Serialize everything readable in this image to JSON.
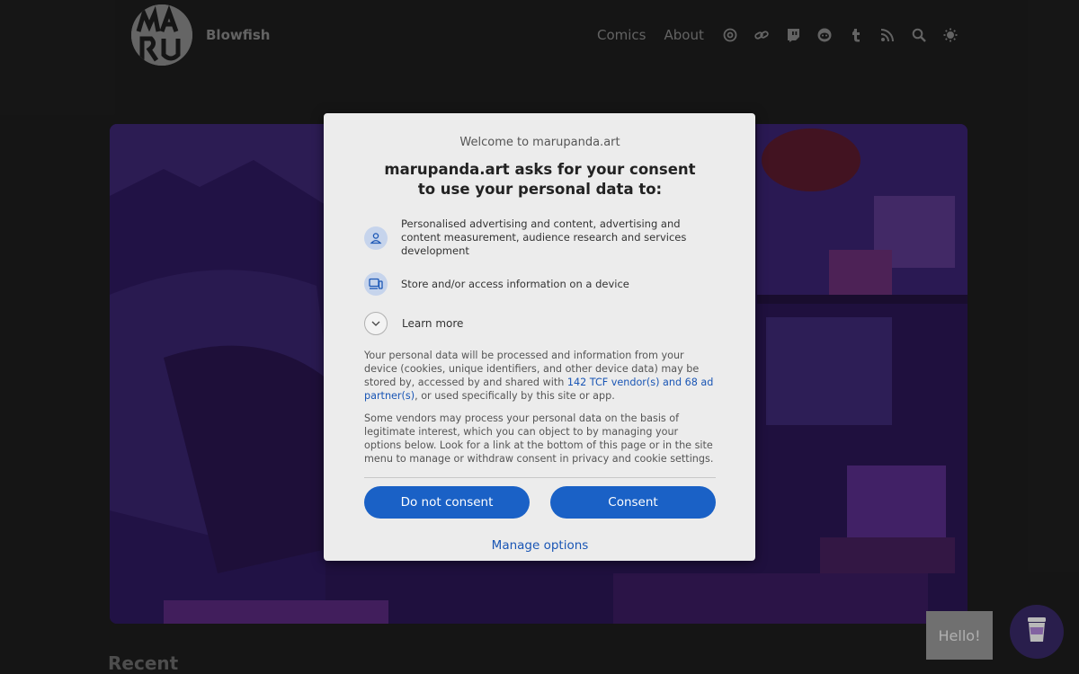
{
  "header": {
    "site_name": "Blowfish",
    "nav_links": [
      "Comics",
      "About"
    ],
    "nav_icons": [
      "at-icon",
      "link-icon",
      "twitch-icon",
      "reddit-icon",
      "tumblr-icon",
      "rss-icon",
      "search-icon",
      "theme-toggle-icon"
    ]
  },
  "main": {
    "recent_heading": "Recent"
  },
  "widgets": {
    "hello_text": "Hello!"
  },
  "consent": {
    "welcome": "Welcome to marupanda.art",
    "headline": "marupanda.art asks for your consent to use your personal data to:",
    "purposes": [
      {
        "icon": "person-icon",
        "text": "Personalised advertising and content, advertising and content measurement, audience research and services development"
      },
      {
        "icon": "device-icon",
        "text": "Store and/or access information on a device"
      }
    ],
    "learn_more": "Learn more",
    "para1_before": "Your personal data will be processed and information from your device (cookies, unique identifiers, and other device data) may be stored by, accessed by and shared with ",
    "para1_link": "142 TCF vendor(s) and 68 ad partner(s)",
    "para1_after": ", or used specifically by this site or app.",
    "para2": "Some vendors may process your personal data on the basis of legitimate interest, which you can object to by managing your options below. Look for a link at the bottom of this page or in the site menu to manage or withdraw consent in privacy and cookie settings.",
    "do_not_consent": "Do not consent",
    "consent": "Consent",
    "manage_options": "Manage options"
  },
  "colors": {
    "page_bg": "#1e1e1e",
    "dialog_bg": "#ececec",
    "primary": "#1a61c6",
    "link": "#1a56b5"
  }
}
